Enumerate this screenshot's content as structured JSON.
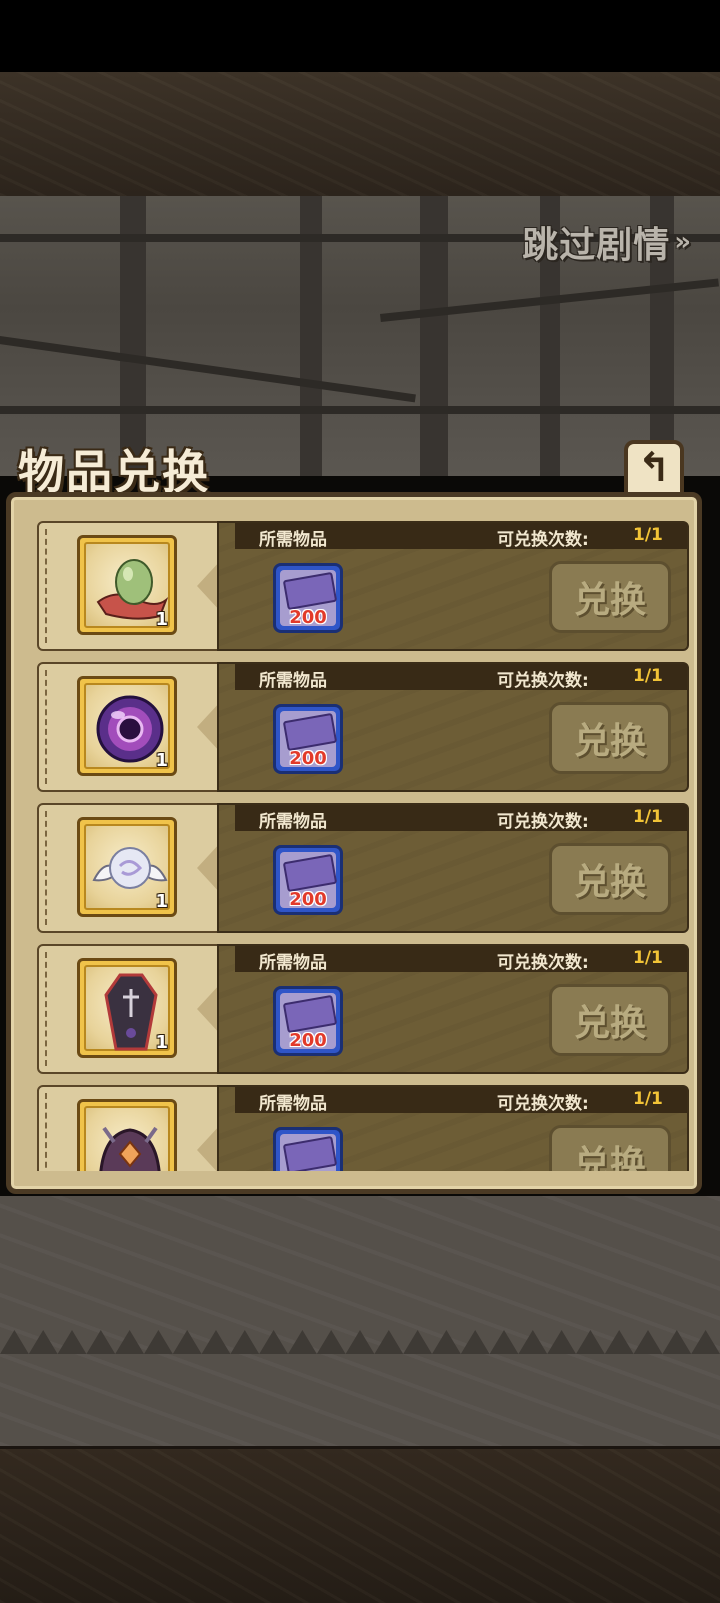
{
  "skip_story": {
    "label": "跳过剧情",
    "icon": "double-chevron-right-icon",
    "chevron": "»"
  },
  "panel": {
    "title": "物品兑换",
    "back_icon": "return-arrow-icon",
    "back_glyph": "↰"
  },
  "rows": [
    {
      "item_icon": "egg-on-cloth-icon",
      "item_qty": "1",
      "required_label": "所需物品",
      "limit_label": "可兑换次数:",
      "limit_value": "1/1",
      "cost_icon": "ticket-icon",
      "cost_amount": "200",
      "button_label": "兑换"
    },
    {
      "item_icon": "purple-orb-icon",
      "item_qty": "1",
      "required_label": "所需物品",
      "limit_label": "可兑换次数:",
      "limit_value": "1/1",
      "cost_icon": "ticket-icon",
      "cost_amount": "200",
      "button_label": "兑换"
    },
    {
      "item_icon": "winged-pearl-icon",
      "item_qty": "1",
      "required_label": "所需物品",
      "limit_label": "可兑换次数:",
      "limit_value": "1/1",
      "cost_icon": "ticket-icon",
      "cost_amount": "200",
      "button_label": "兑换"
    },
    {
      "item_icon": "coffin-icon",
      "item_qty": "1",
      "required_label": "所需物品",
      "limit_label": "可兑换次数:",
      "limit_value": "1/1",
      "cost_icon": "ticket-icon",
      "cost_amount": "200",
      "button_label": "兑换"
    },
    {
      "item_icon": "helmet-mask-icon",
      "item_qty": "",
      "required_label": "所需物品",
      "limit_label": "可兑换次数:",
      "limit_value": "1/1",
      "cost_icon": "ticket-icon",
      "cost_amount": "",
      "button_label": "兑换"
    }
  ],
  "colors": {
    "count_accent": "#f2c437",
    "cost_red": "#e23a2a",
    "frame_gold": "#f0c34a",
    "frame_blue": "#2f55c8"
  }
}
